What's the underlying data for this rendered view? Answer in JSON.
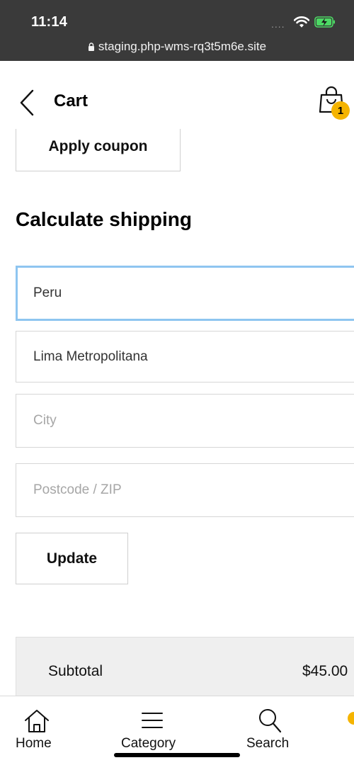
{
  "status_bar": {
    "time": "11:14",
    "signal_dots": "....",
    "url": "staging.php-wms-rq3t5m6e.site",
    "battery_color": "#4cd964"
  },
  "header": {
    "title": "Cart",
    "cart_count": "1",
    "badge_color": "#f5b400"
  },
  "coupon": {
    "apply_label": "Apply coupon"
  },
  "shipping": {
    "title": "Calculate shipping",
    "country_value": "Peru",
    "state_value": "Lima Metropolitana",
    "city_placeholder": "City",
    "postcode_placeholder": "Postcode / ZIP",
    "update_label": "Update",
    "active_field_border": "#8ec5f0"
  },
  "totals": {
    "subtotal_label": "Subtotal",
    "subtotal_value": "$45.00"
  },
  "bottom_nav": {
    "items": [
      {
        "label": "Home",
        "icon": "home-icon"
      },
      {
        "label": "Category",
        "icon": "menu-icon"
      },
      {
        "label": "Search",
        "icon": "search-icon"
      }
    ]
  }
}
